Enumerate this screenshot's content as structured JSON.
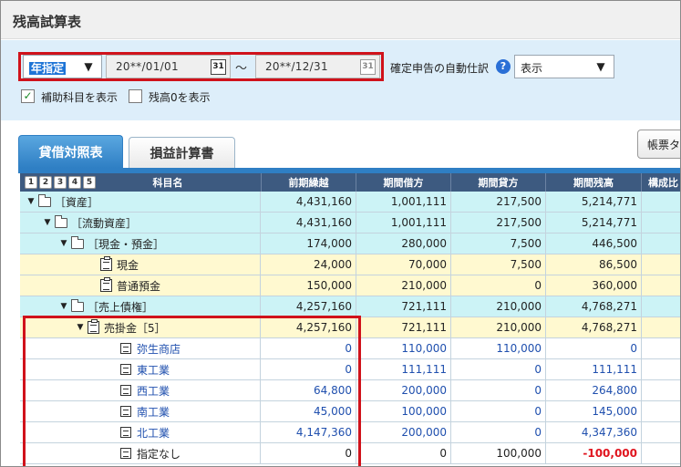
{
  "window": {
    "title": "残高試算表"
  },
  "filters": {
    "period_select": {
      "value": "年指定"
    },
    "date_from": {
      "value": "20**/01/01",
      "icon": "calendar-icon",
      "icon_text": "31"
    },
    "separator": "～",
    "date_to": {
      "value": "20**/12/31",
      "icon": "calendar-icon",
      "icon_text": "31"
    },
    "auto_journal_label": "確定申告の自動仕訳",
    "auto_journal_select": {
      "value": "表示"
    },
    "show_sub_accounts": {
      "label": "補助科目を表示",
      "checked": true
    },
    "show_zero_balance": {
      "label": "残高0を表示",
      "checked": false
    },
    "help_icon_text": "?"
  },
  "tabs": [
    {
      "label": "貸借対照表",
      "active": true
    },
    {
      "label": "損益計算書",
      "active": false
    }
  ],
  "report_button": {
    "label": "帳票タ"
  },
  "table": {
    "level_buttons": [
      "1",
      "2",
      "3",
      "4",
      "5"
    ],
    "headers": [
      "科目名",
      "前期繰越",
      "期間借方",
      "期間貸方",
      "期間残高",
      "構成比"
    ],
    "rows": [
      {
        "name": "［資産］",
        "values": [
          "4,431,160",
          "1,001,111",
          "217,500",
          "5,214,771"
        ]
      },
      {
        "name": "［流動資産］",
        "values": [
          "4,431,160",
          "1,001,111",
          "217,500",
          "5,214,771"
        ]
      },
      {
        "name": "［現金・預金］",
        "values": [
          "174,000",
          "280,000",
          "7,500",
          "446,500"
        ]
      },
      {
        "name": "現金",
        "values": [
          "24,000",
          "70,000",
          "7,500",
          "86,500"
        ]
      },
      {
        "name": "普通預金",
        "values": [
          "150,000",
          "210,000",
          "0",
          "360,000"
        ]
      },
      {
        "name": "［売上債権］",
        "values": [
          "4,257,160",
          "721,111",
          "210,000",
          "4,768,271"
        ]
      },
      {
        "name": "売掛金［5］",
        "values": [
          "4,257,160",
          "721,111",
          "210,000",
          "4,768,271"
        ]
      },
      {
        "name": "弥生商店",
        "values": [
          "0",
          "110,000",
          "110,000",
          "0"
        ]
      },
      {
        "name": "東工業",
        "values": [
          "0",
          "111,111",
          "0",
          "111,111"
        ]
      },
      {
        "name": "西工業",
        "values": [
          "64,800",
          "200,000",
          "0",
          "264,800"
        ]
      },
      {
        "name": "南工業",
        "values": [
          "45,000",
          "100,000",
          "0",
          "145,000"
        ]
      },
      {
        "name": "北工業",
        "values": [
          "4,147,360",
          "200,000",
          "0",
          "4,347,360"
        ]
      },
      {
        "name": "指定なし",
        "values": [
          "0",
          "0",
          "100,000",
          "-100,000"
        ]
      }
    ]
  },
  "colors": {
    "header_bg": "#3d5a80",
    "cyan_row": "#ccf3f6",
    "yellow_row": "#fff9d0",
    "sub_account_text": "#1f4fae",
    "negative_text": "#e0141e",
    "highlight_border": "#d0121b"
  }
}
